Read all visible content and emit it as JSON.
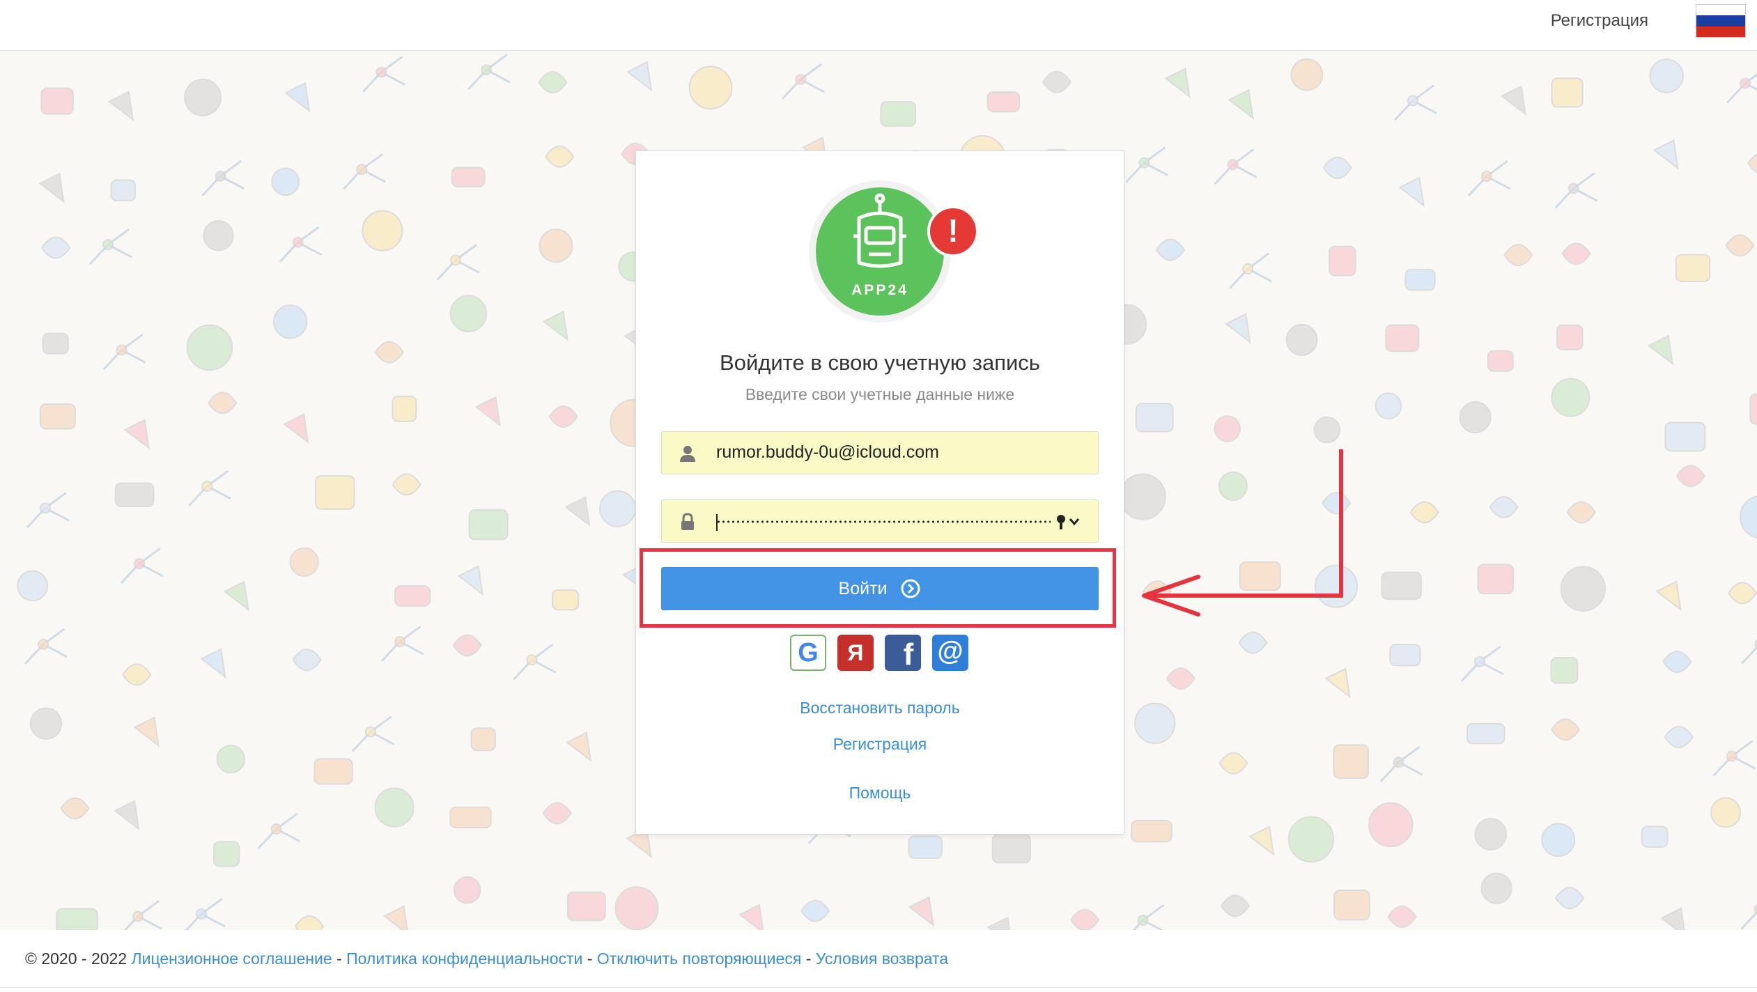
{
  "header": {
    "register_label": "Регистрация",
    "language_flag": "russia-flag",
    "flag_colors": [
      "#ffffff",
      "#1c3fa3",
      "#d52b1e"
    ]
  },
  "login": {
    "logo_text": "APP24",
    "alert_symbol": "!",
    "title": "Войдите в свою учетную запись",
    "subtitle": "Введите свои учетные данные ниже",
    "email_value": "rumor.buddy-0u@icloud.com",
    "password_masked": true,
    "submit_label": "Войти",
    "social": [
      {
        "name": "google",
        "glyph": "G"
      },
      {
        "name": "yandex",
        "glyph": "Я"
      },
      {
        "name": "facebook",
        "glyph": "f"
      },
      {
        "name": "mail-ru",
        "glyph": "@"
      }
    ],
    "restore_password": "Восстановить пароль",
    "register": "Регистрация",
    "help": "Помощь"
  },
  "footer": {
    "copyright": "© 2020 - 2022",
    "separator": "-",
    "links": [
      "Лицензионное соглашение",
      "Политика конфиденциальности",
      "Отключить повторяющиеся",
      "Условия возврата"
    ]
  },
  "colors": {
    "primary_button": "#4292e6",
    "link": "#3a8ed4",
    "logo_green": "#5cc25c",
    "annotation_red": "#e53340",
    "input_autofill": "#fafac6"
  }
}
